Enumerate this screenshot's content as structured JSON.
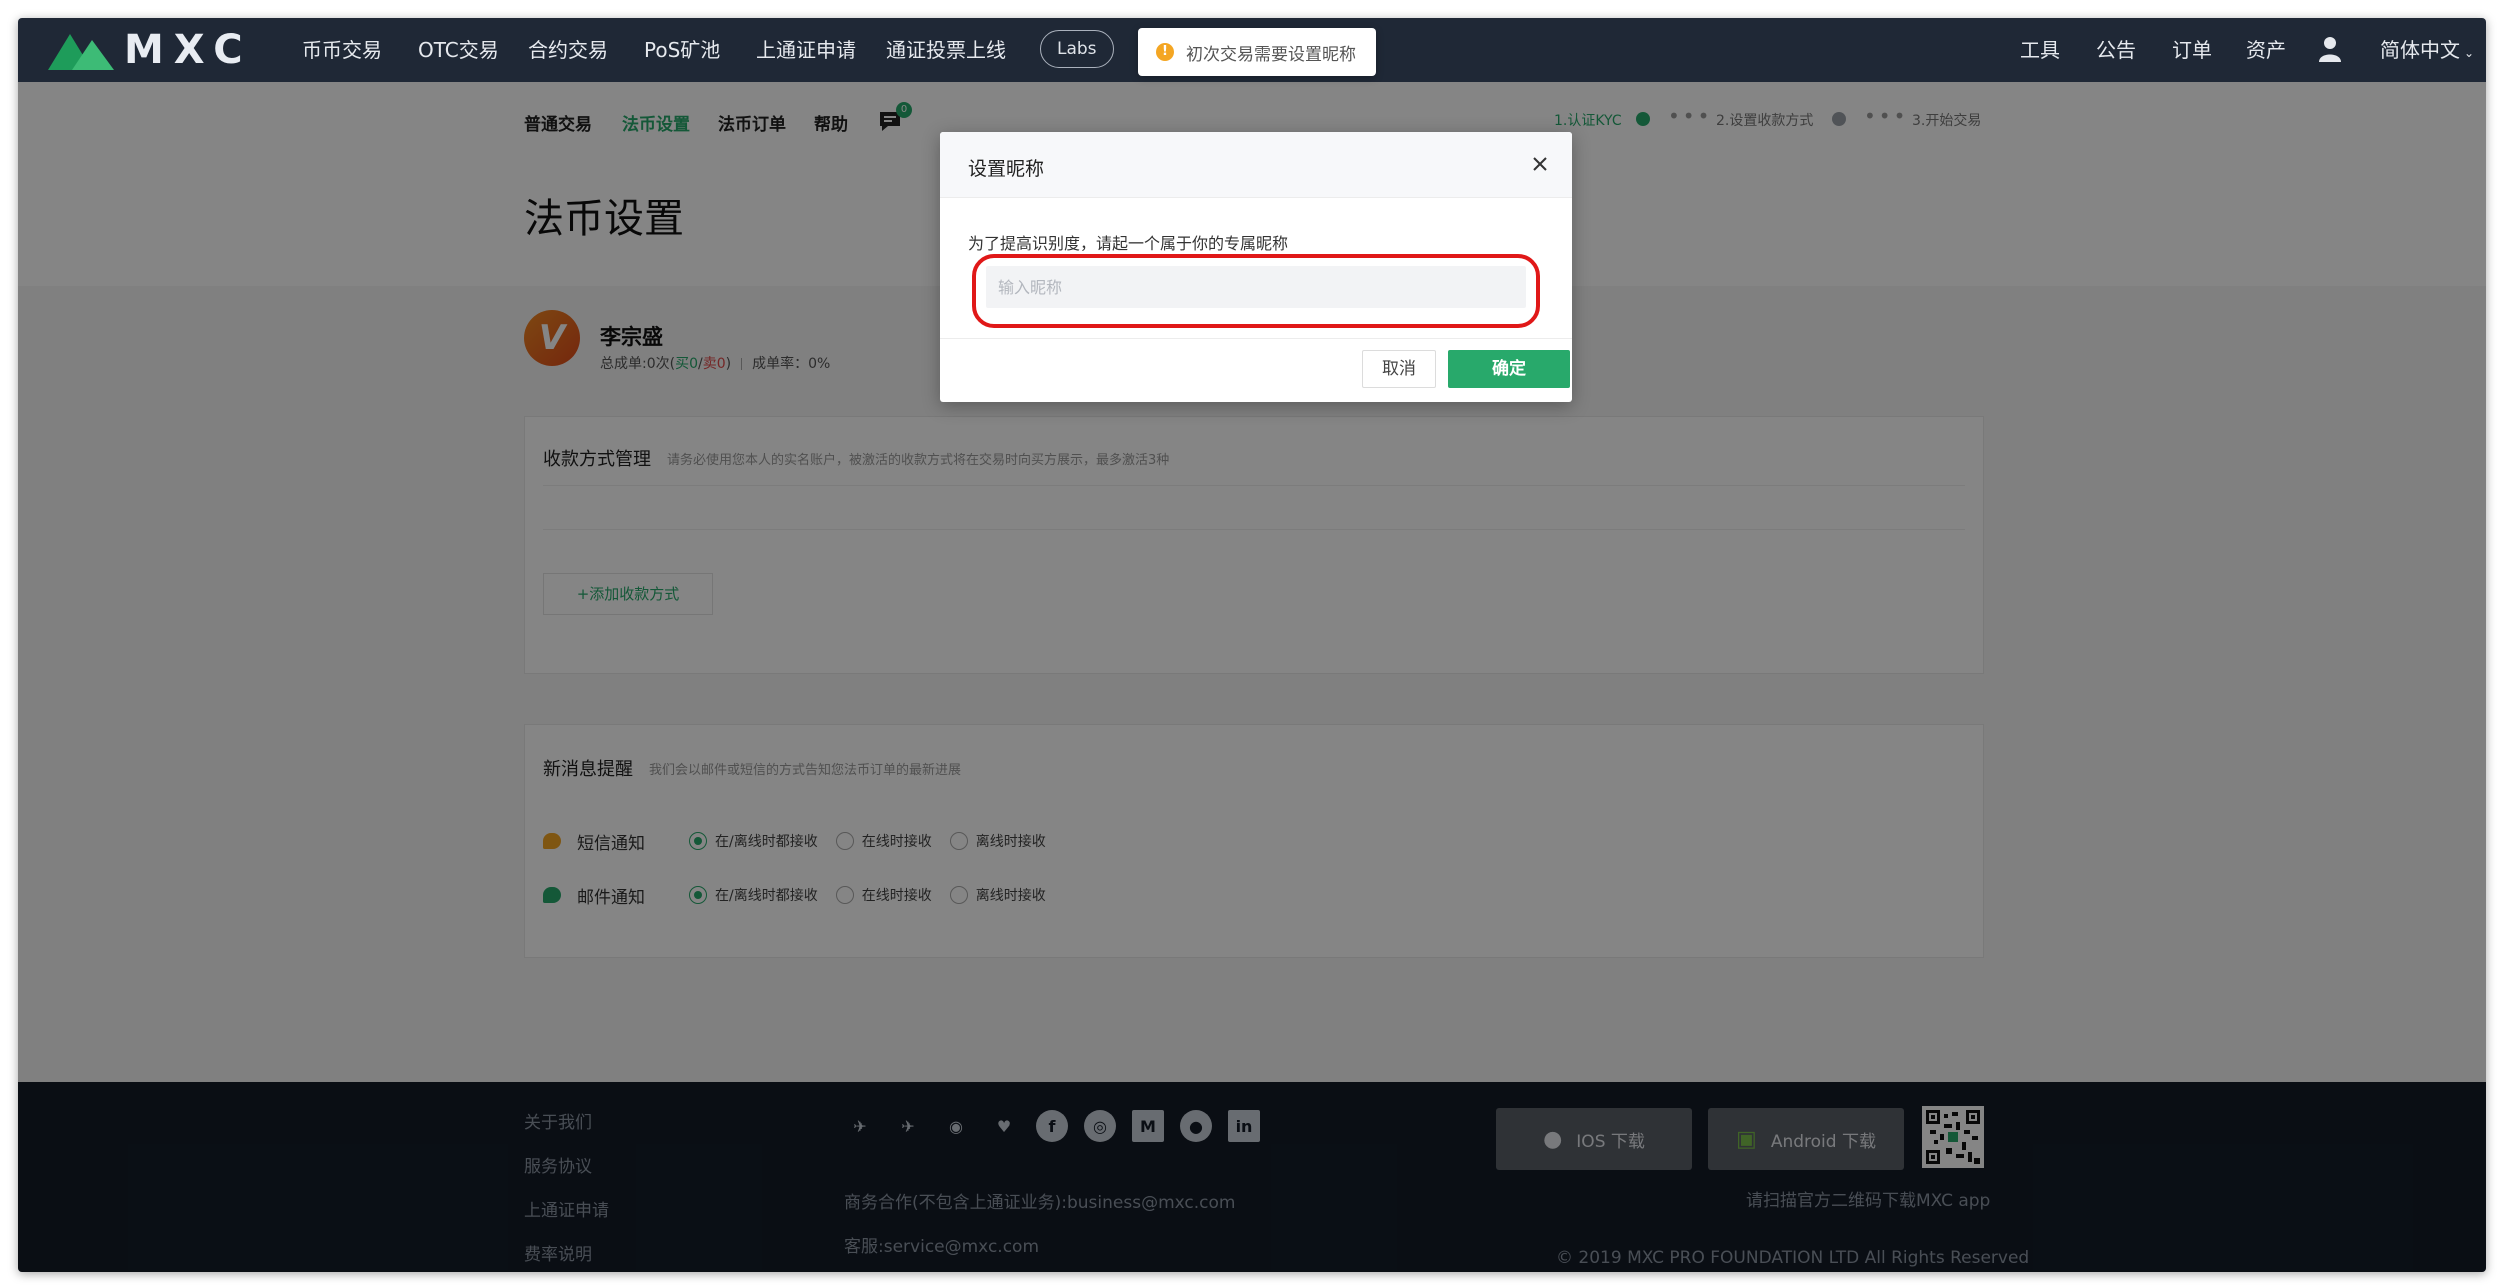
{
  "nav": {
    "logo_text": "MXC",
    "items": [
      "币币交易",
      "OTC交易",
      "合约交易",
      "PoS矿池",
      "上通证申请",
      "通证投票上线"
    ],
    "labs": "Labs",
    "right_items": [
      "工具",
      "公告",
      "订单",
      "资产"
    ],
    "language": "简体中文"
  },
  "toast": {
    "icon": "!",
    "text": "初次交易需要设置昵称"
  },
  "subnav": {
    "items": [
      "普通交易",
      "法币设置",
      "法币订单",
      "帮助"
    ],
    "active_index": 1,
    "chat_badge": "0"
  },
  "steps": {
    "step1": "1.认证KYC",
    "step2": "2.设置收款方式",
    "step3": "3.开始交易"
  },
  "page_title": "法币设置",
  "user": {
    "avatar_letter": "V",
    "name": "李宗盛",
    "stats_prefix": "总成单:0次(",
    "buy": "买0",
    "slash": "/",
    "sell": "卖0",
    "stats_suffix": ")",
    "rate": "成单率：0%"
  },
  "payment": {
    "title": "收款方式管理",
    "hint": "请务必使用您本人的实名账户，被激活的收款方式将在交易时向买方展示，最多激活3种",
    "add_label": "+添加收款方式"
  },
  "notify": {
    "title": "新消息提醒",
    "hint": "我们会以邮件或短信的方式告知您法币订单的最新进展",
    "rows": [
      {
        "label": "短信通知",
        "options": [
          "在/离线时都接收",
          "在线时接收",
          "离线时接收"
        ],
        "selected": 0
      },
      {
        "label": "邮件通知",
        "options": [
          "在/离线时都接收",
          "在线时接收",
          "离线时接收"
        ],
        "selected": 0
      }
    ]
  },
  "footer": {
    "links": [
      "关于我们",
      "服务协议",
      "上通证申请",
      "费率说明"
    ],
    "business": "商务合作(不包含上通证业务):business@mxc.com",
    "service": "客服:service@mxc.com",
    "ios": "IOS 下载",
    "android": "Android 下载",
    "qr_text": "请扫描官方二维码下载MXC app",
    "copyright": "© 2019 MXC PRO FOUNDATION LTD All Rights Reserved"
  },
  "modal": {
    "title": "设置昵称",
    "desc": "为了提高识别度，请起一个属于你的专属昵称",
    "input_placeholder": "输入昵称",
    "input_value": "",
    "cancel": "取消",
    "ok": "确定"
  },
  "colors": {
    "accent": "#28a96b",
    "nav_bg": "#1f2836",
    "footer_bg": "#141c28",
    "annotation": "#e01818"
  }
}
